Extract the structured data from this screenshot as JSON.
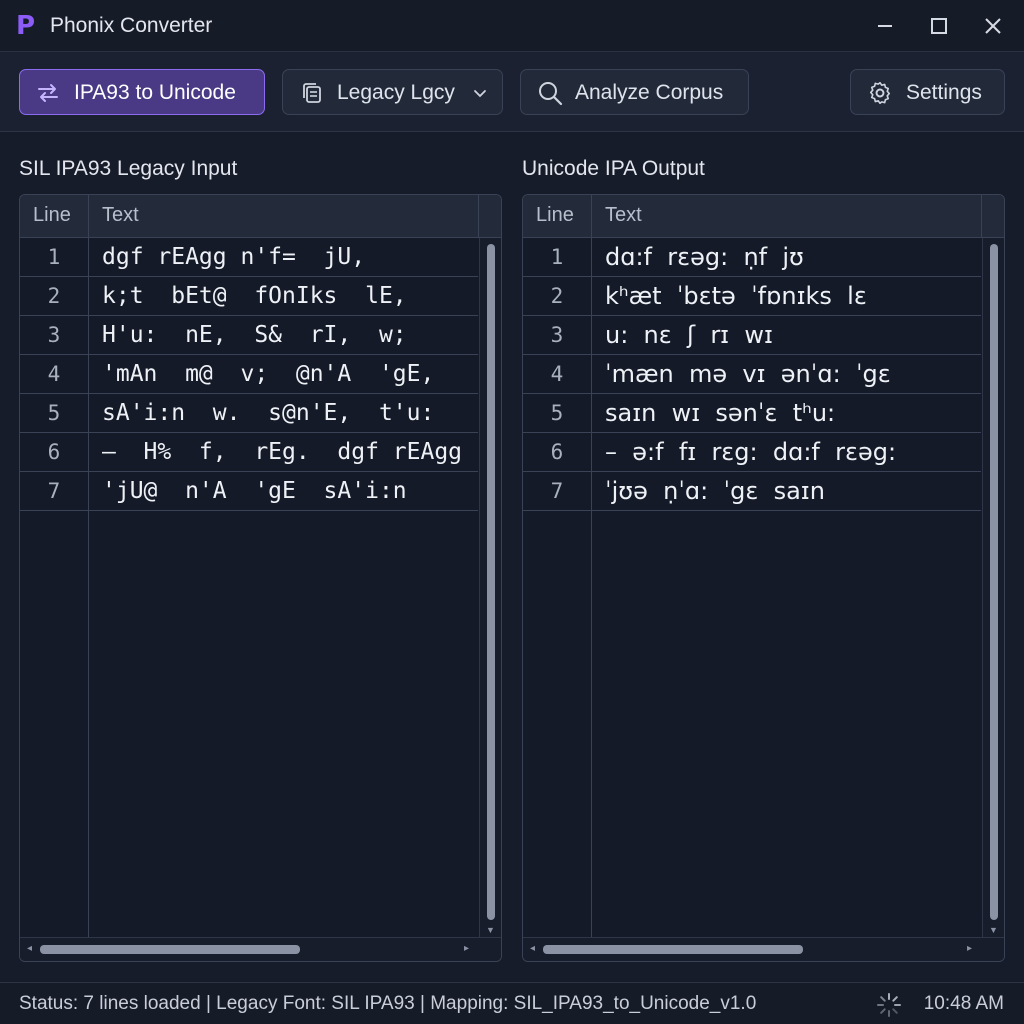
{
  "window": {
    "title": "Phonix Converter",
    "logo_letter": "P",
    "accent_color": "#8b5cf6"
  },
  "toolbar": {
    "ipa_to_unicode_label": "IPA93 to Unicode",
    "legacy_label": "Legacy Lgcy",
    "analyze_label": "Analyze Corpus",
    "settings_label": "Settings",
    "icons": [
      "swap-arrows-icon",
      "copy-pages-icon",
      "chevron-down-icon",
      "search-icon",
      "gear-icon"
    ]
  },
  "left_panel": {
    "label": "SIL IPA93 Legacy Input",
    "columns": [
      "Line",
      "Text"
    ],
    "rows": [
      {
        "num": "1",
        "text": "dgf rEAgg n'f=  jU,"
      },
      {
        "num": "2",
        "text": "k;t  bEt@  fOnIks  lE,"
      },
      {
        "num": "3",
        "text": "H'u:  nE,  S&  rI,  w;"
      },
      {
        "num": "4",
        "text": "'mAn  m@  v;  @n'A  'gE,"
      },
      {
        "num": "5",
        "text": "sA'i:n  w.  s@n'E,  t'u:"
      },
      {
        "num": "6",
        "text": "–  H%  f,  rEg.  dgf rEAgg"
      },
      {
        "num": "7",
        "text": "'jU@  n'A  'gE  sA'i:n"
      }
    ]
  },
  "right_panel": {
    "label": "Unicode IPA Output",
    "columns": [
      "Line",
      "Text"
    ],
    "rows": [
      {
        "num": "1",
        "text": "dɑ:f  rɛəg:  ṇf  jʊ"
      },
      {
        "num": "2",
        "text": "kʰæt  ˈbɛtə  ˈfɒnɪks  lɛ"
      },
      {
        "num": "3",
        "text": "u:  nɛ  ʃ  rɪ  wɪ"
      },
      {
        "num": "4",
        "text": "ˈmæn  mə  vɪ  ənˈɑ:  ˈgɛ"
      },
      {
        "num": "5",
        "text": "saɪn  wɪ  sənˈɛ  tʰu:"
      },
      {
        "num": "6",
        "text": "–  ə:f  fɪ  rɛg:  dɑ:f  rɛəg:"
      },
      {
        "num": "7",
        "text": "ˈjʊə  ṇˈɑ:  ˈgɛ  saɪn"
      }
    ]
  },
  "status": {
    "text": "Status: 7 lines loaded | Legacy Font: SIL IPA93 | Mapping: SIL_IPA93_to_Unicode_v1.0",
    "time": "10:48 AM"
  }
}
